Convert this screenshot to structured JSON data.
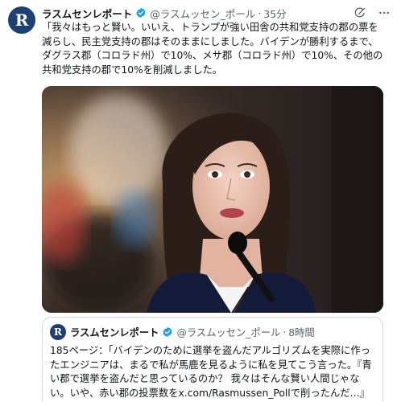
{
  "tweet": {
    "avatar_letter": "R",
    "author_name": "ラスムセンレポート",
    "handle": "@ラスムッセン_ポール",
    "separator": "·",
    "time": "35分",
    "text_lines": [
      "「我々はもっと賢い。いいえ、トランプが強い田舎の共和党支持の郡の票を",
      "減らし、民主党支持の郡はそのままにしました。バイデンが勝利するまで、",
      "ダグラス郡（コロラド州）で10%、メサ郡（コロラド州）で10%、その他の",
      "共和党支持の郡で10%を削減しました。"
    ]
  },
  "quote": {
    "avatar_letter": "R",
    "author_name": "ラスムセンレポート",
    "handle": "@ラスムッセン_ポール",
    "separator": "·",
    "time": "8時間",
    "text_lines": [
      "185ページ：「バイデンのために選挙を盗んだアルゴリズムを実際に作っ",
      "たエンジニアは、まるで私が馬鹿を見るように私を見てこう言った。『青",
      "い郡で選挙を盗んだと思っているのか？ 我々はそんな賢い人間じゃな",
      "い。いや、赤い郡の投票数をx.com/Rasmussen_Pollで削ったんだ…』"
    ]
  },
  "icons": {
    "verified": "verified-badge-icon",
    "grok": "grok-icon",
    "more": "more-options-icon"
  },
  "colors": {
    "verified_blue": "#1d9bf0",
    "avatar_navy": "#1d3f72",
    "secondary_text": "#536471",
    "border": "#cfd9de"
  }
}
